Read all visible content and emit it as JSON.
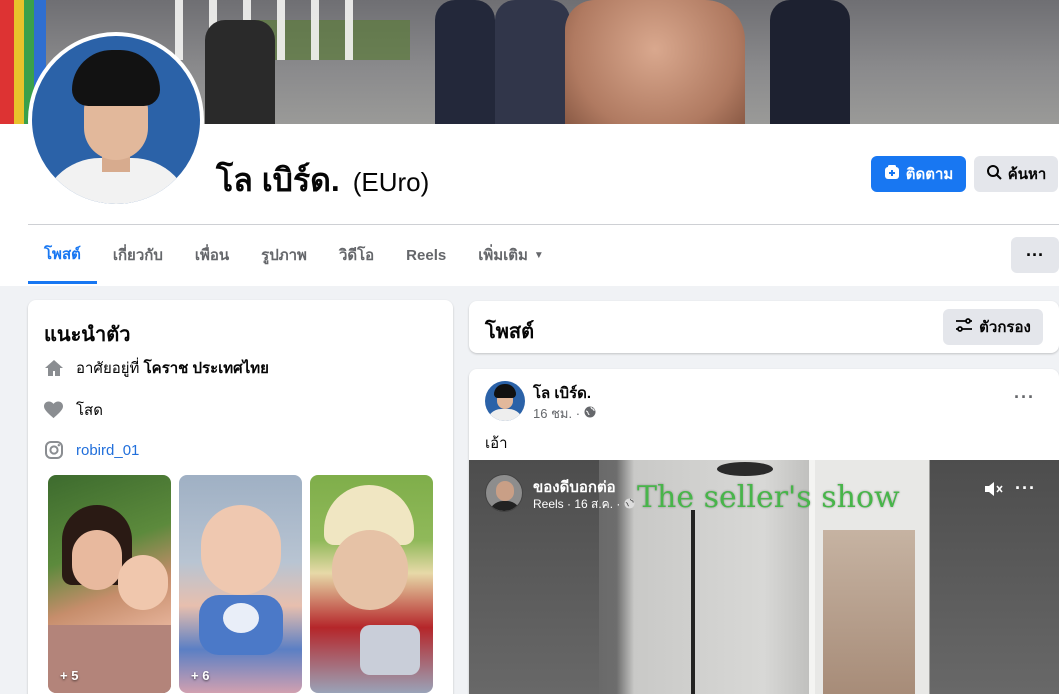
{
  "profile": {
    "name": "โล เบิร์ด.",
    "alternate_name": "(EUro)",
    "follow_label": "ติดตาม",
    "search_label": "ค้นหา"
  },
  "tabs": [
    {
      "label": "โพสต์",
      "active": true
    },
    {
      "label": "เกี่ยวกับ"
    },
    {
      "label": "เพื่อน"
    },
    {
      "label": "รูปภาพ"
    },
    {
      "label": "วิดีโอ"
    },
    {
      "label": "Reels"
    },
    {
      "label": "เพิ่มเติม"
    }
  ],
  "intro": {
    "title": "แนะนำตัว",
    "lives_prefix": "อาศัยอยู่ที่",
    "lives_place": "โคราช ประเทศไทย",
    "relationship": "โสด",
    "instagram": "robird_01",
    "photos": [
      {
        "count": "+ 5",
        "icon": "photo-woman-child"
      },
      {
        "count": "+ 6",
        "icon": "photo-baby"
      },
      {
        "count": "",
        "icon": "photo-newborn"
      }
    ]
  },
  "posts_header": {
    "title": "โพสต์",
    "filter_label": "ตัวกรอง"
  },
  "post": {
    "author": "โล เบิร์ด.",
    "time": "16 ชม. ·",
    "text": "เอ้า",
    "reel": {
      "page_name": "ของดีบอกต่อ",
      "meta": "Reels · 16 ส.ค. ·",
      "overlay_text": "The seller's show"
    }
  },
  "colors": {
    "accent": "#1877f2",
    "page_bg": "#f0f2f5",
    "button_gray": "#e4e6eb",
    "muted_text": "#65676b",
    "overlay_green": "#48b54a"
  }
}
